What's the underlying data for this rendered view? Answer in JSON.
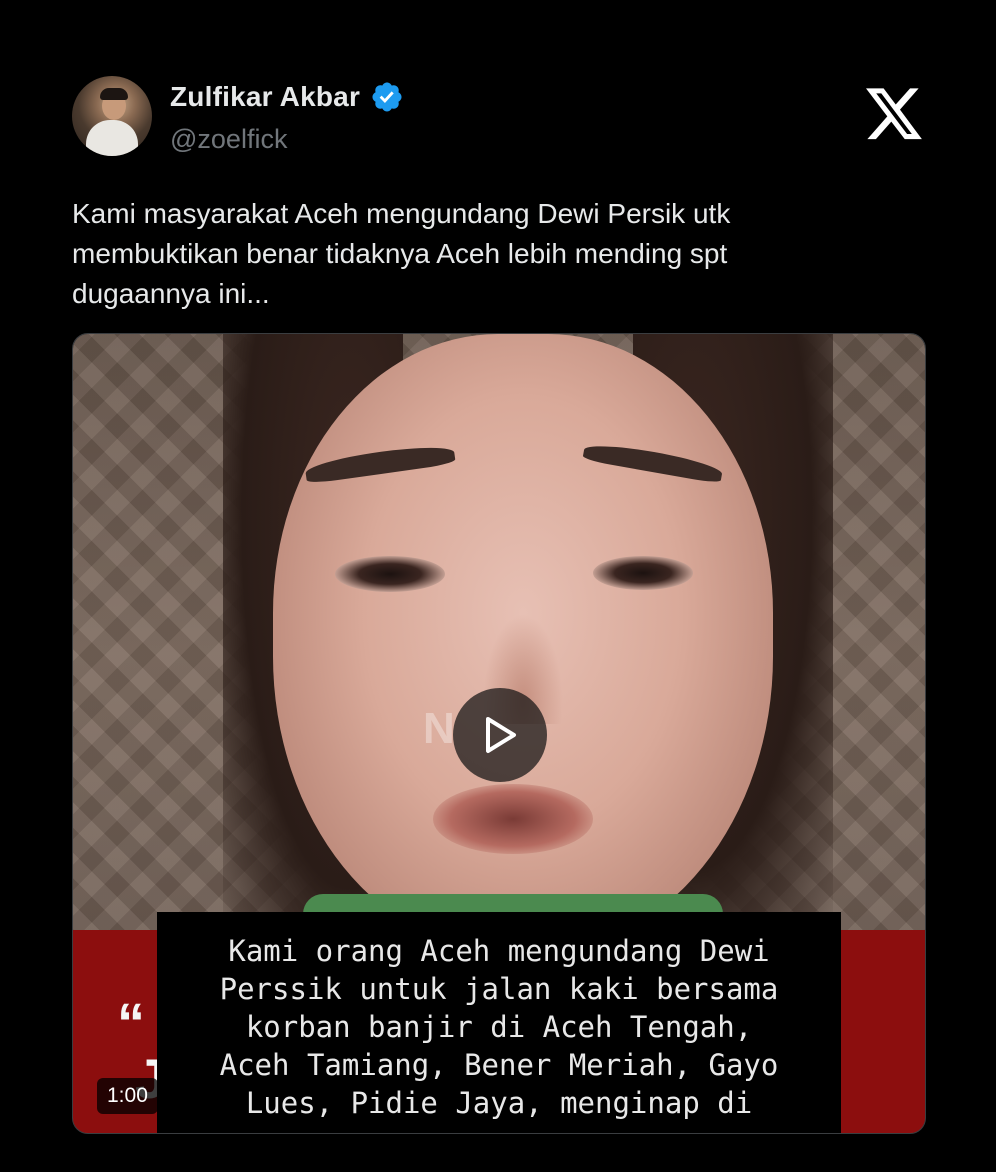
{
  "author": {
    "display_name": "Zulfikar Akbar",
    "handle": "@zoelfick",
    "verified": true
  },
  "platform": {
    "logo_icon": "x-logo-icon"
  },
  "tweet": {
    "text": "Kami masyarakat Aceh mengundang Dewi Persik utk membuktikan benar tidaknya Aceh lebih mending spt dugaannya ini..."
  },
  "media": {
    "type": "video",
    "duration": "1:00",
    "play_icon": "play-icon",
    "caption_lines": [
      "Kami orang Aceh mengundang Dewi",
      "Perssik untuk jalan kaki bersama",
      "korban banjir di Aceh Tengah,",
      "Aceh Tamiang, Bener Meriah, Gayo",
      "Lues, Pidie Jaya, menginap di"
    ],
    "banner_fragments": [
      "“",
      "J"
    ],
    "watermark": "N"
  },
  "colors": {
    "background": "#000000",
    "text_primary": "#e7e9ea",
    "text_secondary": "#71767b",
    "verified_blue": "#1d9bf0",
    "banner_red": "#8c0e0e"
  }
}
